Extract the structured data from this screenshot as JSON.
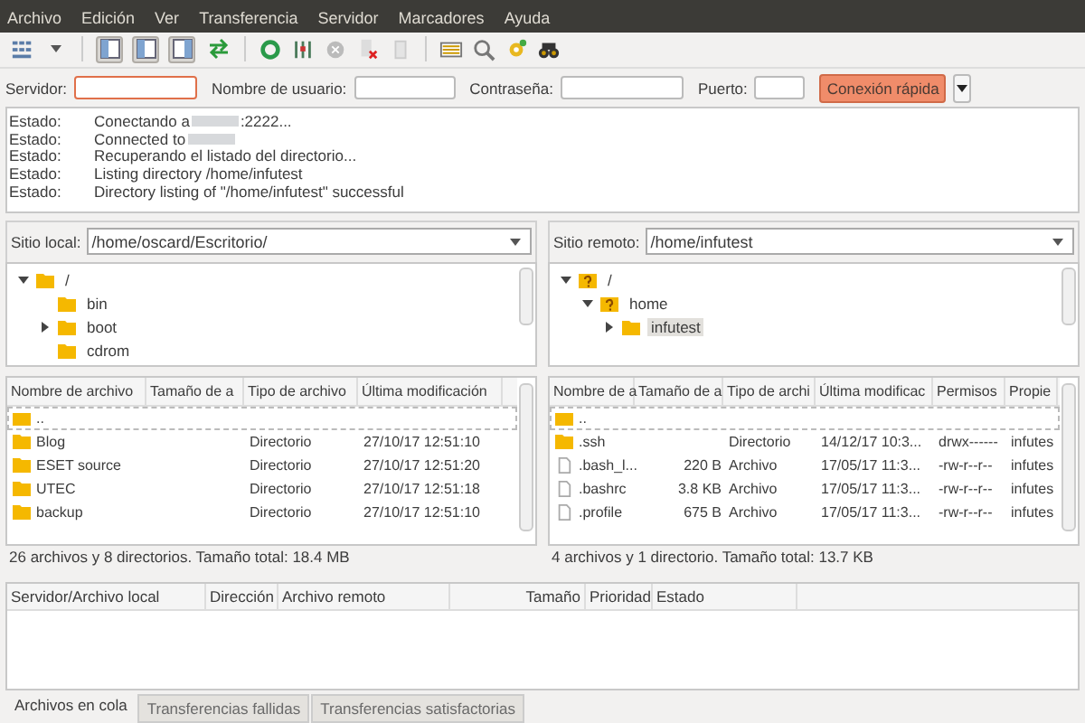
{
  "menu": [
    "Archivo",
    "Edición",
    "Ver",
    "Transferencia",
    "Servidor",
    "Marcadores",
    "Ayuda"
  ],
  "view_toggles": [
    {
      "on": true
    },
    {
      "on": true
    },
    {
      "on": true
    },
    {
      "on": false
    }
  ],
  "quickconnect": {
    "fields": [
      {
        "label": "Servidor:",
        "focused": true
      },
      {
        "label": "Nombre de usuario:",
        "focused": false
      },
      {
        "label": "Contraseña:",
        "focused": false
      },
      {
        "label": "Puerto:",
        "focused": false
      }
    ],
    "button": "Conexión rápida"
  },
  "log": [
    {
      "label": "Estado:",
      "before": "Conectando a",
      "redacted_ip": true,
      "after": ":2222..."
    },
    {
      "label": "Estado:",
      "before": "Connected to",
      "redacted_ip": true
    },
    {
      "label": "Estado:",
      "before": "Recuperando el listado del directorio..."
    },
    {
      "label": "Estado:",
      "before": "Listing directory /home/infutest"
    },
    {
      "label": "Estado:",
      "before": "Directory listing of \"/home/infutest\" successful"
    }
  ],
  "local": {
    "site_label": "Sitio local:",
    "path": "/home/oscard/Escritorio/",
    "tree": [
      {
        "name": "/",
        "kind": "folder",
        "expanded": true,
        "selected": false,
        "children": [
          {
            "name": "bin",
            "kind": "folder",
            "expanded": false,
            "selected": false
          },
          {
            "name": "boot",
            "kind": "folder",
            "expanded": false,
            "selected": false,
            "has_children": true
          },
          {
            "name": "cdrom",
            "kind": "folder",
            "expanded": false,
            "selected": false
          }
        ]
      }
    ],
    "columns": [
      "Nombre de archivo",
      "Tamaño de a",
      "Tipo de archivo",
      "Última modificación"
    ],
    "rows": [
      {
        "kind": "parent",
        "cells": [
          "..",
          null,
          null,
          null
        ],
        "focused": true
      },
      {
        "kind": "folder",
        "cells": [
          "Blog",
          null,
          "Directorio",
          "27/10/17 12:51:10"
        ],
        "focused": false
      },
      {
        "kind": "folder",
        "cells": [
          "ESET source",
          null,
          "Directorio",
          "27/10/17 12:51:20"
        ],
        "focused": false
      },
      {
        "kind": "folder",
        "cells": [
          "UTEC",
          null,
          "Directorio",
          "27/10/17 12:51:18"
        ],
        "focused": false
      },
      {
        "kind": "folder",
        "cells": [
          "backup",
          null,
          "Directorio",
          "27/10/17 12:51:10"
        ],
        "focused": false
      }
    ],
    "status": "26 archivos y 8 directorios. Tamaño total: 18.4 MB"
  },
  "remote": {
    "site_label": "Sitio remoto:",
    "path": "/home/infutest",
    "tree": [
      {
        "name": "/",
        "kind": "unknown",
        "expanded": true,
        "selected": false,
        "children": [
          {
            "name": "home",
            "kind": "unknown",
            "expanded": true,
            "selected": false,
            "children": [
              {
                "name": "infutest",
                "kind": "folder",
                "expanded": false,
                "selected": true,
                "has_children": true
              }
            ]
          }
        ]
      }
    ],
    "columns": [
      "Nombre de a",
      "Tamaño de a",
      "Tipo de archi",
      "Última modificac",
      "Permisos",
      "Propie"
    ],
    "rows": [
      {
        "kind": "parent",
        "cells": [
          "..",
          null,
          null,
          null,
          null,
          null
        ],
        "focused": true
      },
      {
        "kind": "folder",
        "cells": [
          ".ssh",
          null,
          "Directorio",
          "14/12/17 10:3...",
          "drwx------",
          "infutes"
        ],
        "focused": false
      },
      {
        "kind": "file",
        "cells": [
          ".bash_l...",
          "220 B",
          "Archivo",
          "17/05/17 11:3...",
          "-rw-r--r--",
          "infutes"
        ],
        "focused": false
      },
      {
        "kind": "file",
        "cells": [
          ".bashrc",
          "3.8 KB",
          "Archivo",
          "17/05/17 11:3...",
          "-rw-r--r--",
          "infutes"
        ],
        "focused": false
      },
      {
        "kind": "file",
        "cells": [
          ".profile",
          "675 B",
          "Archivo",
          "17/05/17 11:3...",
          "-rw-r--r--",
          "infutes"
        ],
        "focused": false
      }
    ],
    "status": "4 archivos y 1 directorio. Tamaño total: 13.7 KB"
  },
  "queue": {
    "columns": [
      "Servidor/Archivo local",
      "Dirección",
      "Archivo remoto",
      "Tamaño",
      "Prioridad",
      "Estado"
    ]
  },
  "tabs": [
    {
      "label": "Archivos en cola",
      "selected": true
    },
    {
      "label": "Transferencias fallidas",
      "selected": false
    },
    {
      "label": "Transferencias satisfactorias",
      "selected": false
    }
  ]
}
